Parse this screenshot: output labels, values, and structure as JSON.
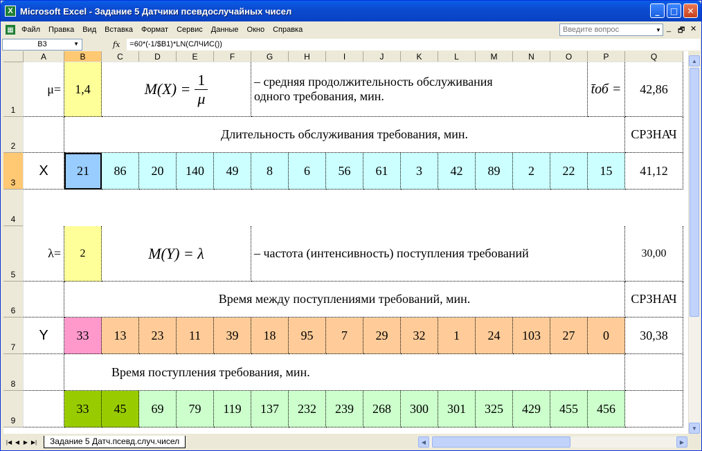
{
  "window": {
    "title": "Microsoft Excel - Задание 5 Датчики псевдослучайных чисел",
    "app_icon": "X"
  },
  "menu": {
    "items": [
      "Файл",
      "Правка",
      "Вид",
      "Вставка",
      "Формат",
      "Сервис",
      "Данные",
      "Окно",
      "Справка"
    ],
    "help_placeholder": "Введите вопрос"
  },
  "formula_bar": {
    "name_box": "B3",
    "fx": "fx",
    "formula": "=60*(-1/$B1)*LN(СЛЧИС())"
  },
  "columns": [
    "A",
    "B",
    "C",
    "D",
    "E",
    "F",
    "G",
    "H",
    "I",
    "J",
    "K",
    "L",
    "M",
    "N",
    "O",
    "P",
    "Q"
  ],
  "rows": [
    "1",
    "2",
    "3",
    "4",
    "5",
    "6",
    "7",
    "8",
    "9"
  ],
  "selected": {
    "column": "B",
    "row": "3"
  },
  "r1": {
    "mu_label": "μ=",
    "mu_value": "1,4",
    "formula_tex": "M(X) = 1/μ",
    "formula_lhs": "M(X) =",
    "formula_num": "1",
    "formula_den": "μ",
    "desc_line1": "– средняя продолжительность обслуживания",
    "desc_line2": "одного требования, мин.",
    "t_label": "t̄об =",
    "t_value": "42,86"
  },
  "r2": {
    "title": "Длительность обслуживания требования, мин.",
    "func": "СРЗНАЧ"
  },
  "r3": {
    "label": "X",
    "values": [
      "21",
      "86",
      "20",
      "140",
      "49",
      "8",
      "6",
      "56",
      "61",
      "3",
      "42",
      "89",
      "2",
      "22",
      "15"
    ],
    "mean": "41,12"
  },
  "r5": {
    "lambda_label": "λ=",
    "lambda_value": "2",
    "formula": "M(Y) = λ",
    "desc": "– частота (интенсивность) поступления требований",
    "value": "30,00"
  },
  "r6": {
    "title": "Время между поступлениями требований, мин.",
    "func": "СРЗНАЧ"
  },
  "r7": {
    "label": "Y",
    "values": [
      "33",
      "13",
      "23",
      "11",
      "39",
      "18",
      "95",
      "7",
      "29",
      "32",
      "1",
      "24",
      "103",
      "27",
      "0"
    ],
    "mean": "30,38"
  },
  "r8": {
    "title": "Время поступления требования, мин."
  },
  "r9": {
    "values": [
      "33",
      "45",
      "69",
      "79",
      "119",
      "137",
      "232",
      "239",
      "268",
      "300",
      "301",
      "325",
      "429",
      "455",
      "456"
    ]
  },
  "sheet_tab": "Задание 5 Датч.псевд.случ.чисел",
  "colors": {
    "yellow": "#ffff99",
    "cyan": "#ccffff",
    "selected_cyan": "#99ccff",
    "orange": "#ffcc99",
    "pink": "#ff99cc",
    "green_dark": "#99cc00",
    "green_light": "#ccffcc"
  }
}
